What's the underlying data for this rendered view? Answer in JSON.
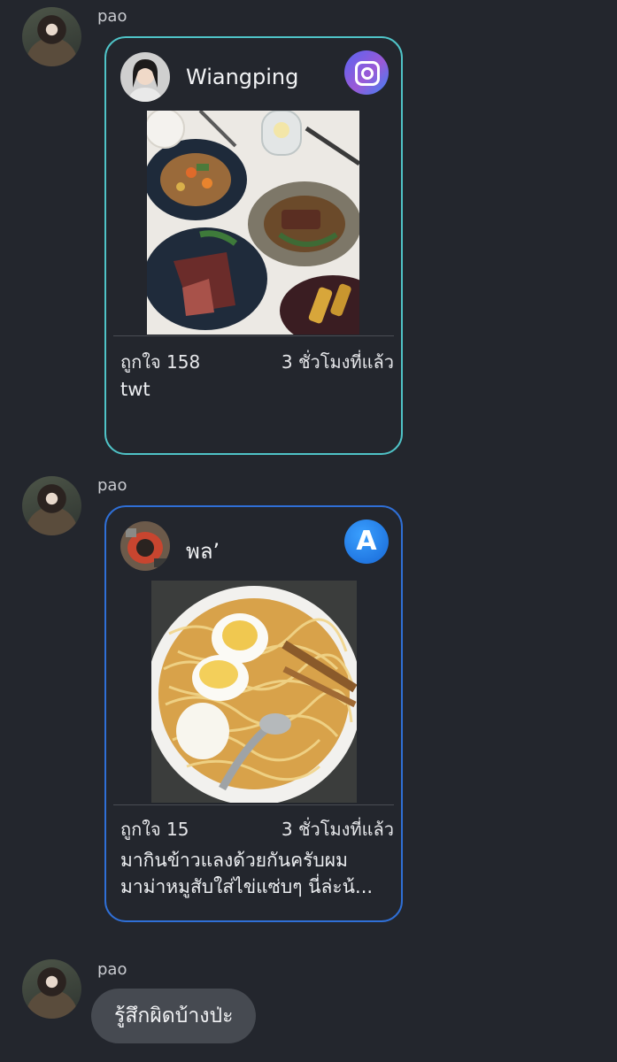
{
  "messages": [
    {
      "sender": "pao",
      "type": "shared_post",
      "post": {
        "author": "Wiangping",
        "app_icon": "instagram-style-icon",
        "likes": "ถูกใจ 158",
        "time": "3 ชั่วโมงที่แล้ว",
        "caption": "twt",
        "border_color": "#4fc3c7"
      }
    },
    {
      "sender": "pao",
      "type": "shared_post",
      "post": {
        "author": "พล’",
        "app_icon": "letter-a-app-icon",
        "badge_letter": "A",
        "likes": "ถูกใจ 15",
        "time": "3 ชั่วโมงที่แล้ว",
        "caption": "มากินข้าวแลงด้วยกันครับผม\nมาม่าหมูสับใส่ไข่แซ่บๆ นี่ล่ะน้...",
        "border_color": "#2f6fd6"
      }
    },
    {
      "sender": "pao",
      "type": "text",
      "text": "รู้สึกผิดบ้างป่ะ"
    }
  ]
}
